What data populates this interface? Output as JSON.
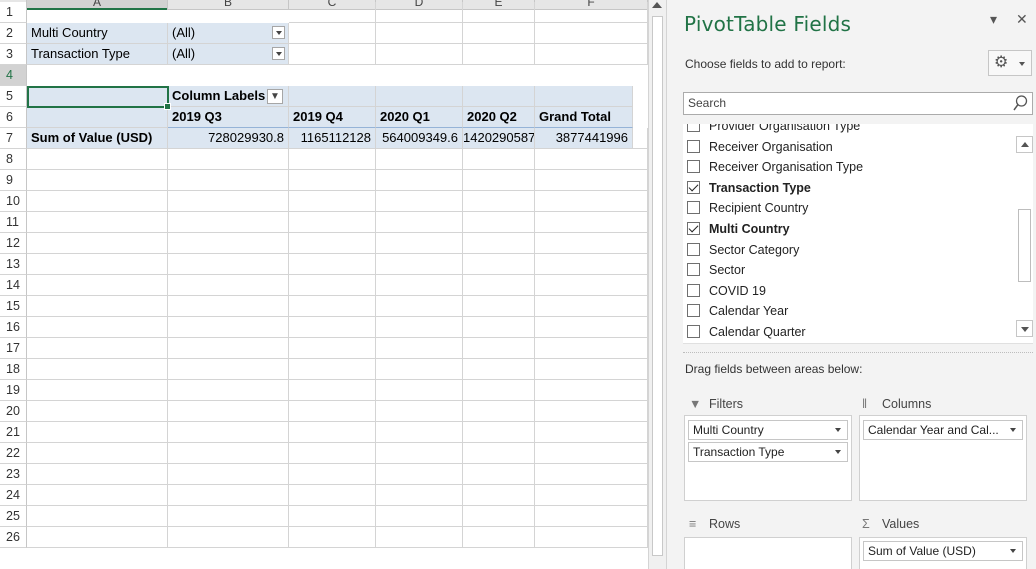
{
  "sheet": {
    "columns": [
      "A",
      "B",
      "C",
      "D",
      "E",
      "F"
    ],
    "rows": [
      "1",
      "2",
      "3",
      "4",
      "5",
      "6",
      "7",
      "8",
      "9",
      "10",
      "11",
      "12",
      "13",
      "14",
      "15",
      "16",
      "17",
      "18",
      "19",
      "20",
      "21",
      "22",
      "23",
      "24",
      "25",
      "26"
    ],
    "filters": [
      {
        "label": "Multi Country",
        "value": "(All)"
      },
      {
        "label": "Transaction Type",
        "value": "(All)"
      }
    ],
    "column_labels": "Column Labels",
    "column_headers": [
      "2019 Q3",
      "2019 Q4",
      "2020 Q1",
      "2020 Q2",
      "Grand Total"
    ],
    "measure_label": "Sum of Value (USD)",
    "values": [
      "728029930.8",
      "1165112128",
      "564009349.6",
      "1420290587",
      "3877441996"
    ]
  },
  "pane": {
    "title": "PivotTable Fields",
    "subtitle": "Choose fields to add to report:",
    "search_placeholder": "Search",
    "fields": [
      {
        "label": "Provider Organisation Type",
        "checked": false
      },
      {
        "label": "Receiver Organisation",
        "checked": false
      },
      {
        "label": "Receiver Organisation Type",
        "checked": false
      },
      {
        "label": "Transaction Type",
        "checked": true
      },
      {
        "label": "Recipient Country",
        "checked": false
      },
      {
        "label": "Multi Country",
        "checked": true
      },
      {
        "label": "Sector Category",
        "checked": false
      },
      {
        "label": "Sector",
        "checked": false
      },
      {
        "label": "COVID 19",
        "checked": false
      },
      {
        "label": "Calendar Year",
        "checked": false
      },
      {
        "label": "Calendar Quarter",
        "checked": false
      }
    ],
    "drag_label": "Drag fields between areas below:",
    "areas": {
      "filters": {
        "label": "Filters",
        "items": [
          "Multi Country",
          "Transaction Type"
        ]
      },
      "columns": {
        "label": "Columns",
        "items": [
          "Calendar Year and Cal..."
        ]
      },
      "rows": {
        "label": "Rows",
        "items": []
      },
      "values": {
        "label": "Values",
        "items": [
          "Sum of Value (USD)"
        ]
      }
    }
  },
  "icons": {
    "gear": "settings-gear-icon",
    "close": "close-icon",
    "dropdown": "chevron-down-icon",
    "search": "search-icon",
    "filter": "filter-funnel-icon",
    "columns": "columns-icon",
    "rows": "rows-icon",
    "values": "sigma-icon"
  },
  "colors": {
    "accent": "#217346",
    "pivot_band": "#dce6f1"
  }
}
